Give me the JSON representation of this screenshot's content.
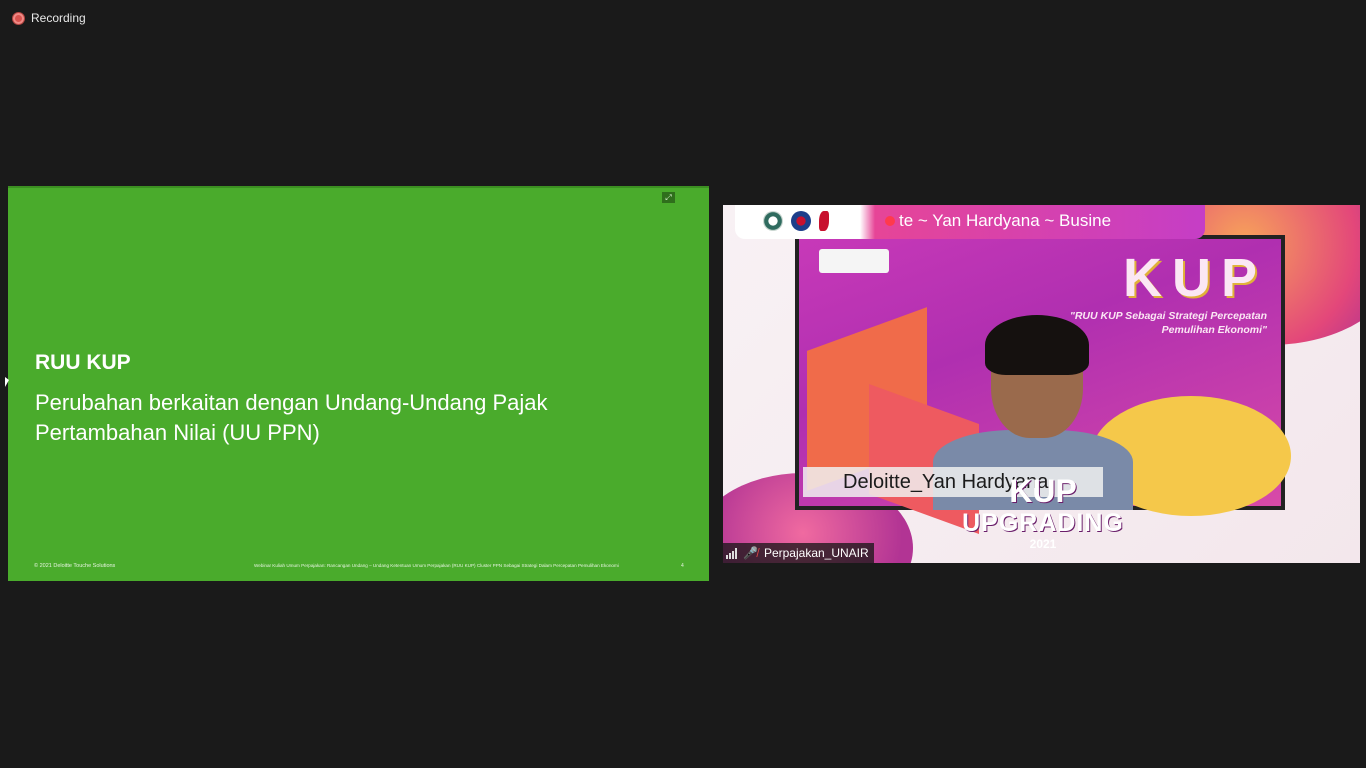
{
  "recording": {
    "label": "Recording",
    "color": "#d9534f"
  },
  "slide": {
    "title": "RUU KUP",
    "subtitle": "Perubahan berkaitan dengan Undang-Undang Pajak Pertambahan Nilai (UU PPN)",
    "copyright": "© 2021 Deloitte Touche Solutions",
    "footer": "Webinar Kuliah Umum Perpajakan: Rancangan Undang – Undang Ketentuan Umum Perpajakan (RUU KUP) Cluster PPN Sebagai Strategi Dalam Percepatan Pemulihan Ekonomi",
    "page_number": "4",
    "background_color": "#4aab2c",
    "expand_icon": "expand-icon"
  },
  "video": {
    "ticker_text": "te ~ Yan Hardyana ~ Busine",
    "screen_heading": "KUP",
    "screen_tagline": "\"RUU KUP Sebagai Strategi Percepatan Pemulihan Ekonomi\"",
    "nameplate": "Deloitte_Yan Hardyana",
    "upgrading_kup": "KUP",
    "upgrading_word": "UPGRADING",
    "upgrading_year": "2021",
    "participant_name": "Perpajakan_UNAIR",
    "signal_icon": "signal-icon",
    "mic_icon": "mic-off-icon"
  }
}
